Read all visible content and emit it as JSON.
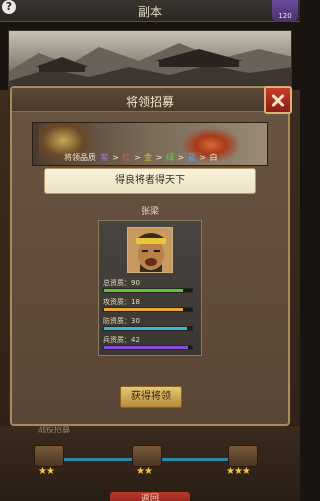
{
  "header": {
    "title": "副本",
    "help_label": "?",
    "badge_value": "120"
  },
  "dialog": {
    "title": "将领招募",
    "rank_label": "将领品质",
    "ranks": [
      "紫",
      "红",
      "金",
      "绿",
      "蓝",
      "白"
    ],
    "rank_colors": [
      "#b070e8",
      "#e85a4a",
      "#e8b838",
      "#58d058",
      "#58a8e8",
      "#f2f2f2"
    ],
    "motto": "得良将者得天下",
    "general_name": "张梁",
    "stats": [
      {
        "label": "总资质：90",
        "value": 90,
        "max": 100,
        "color": "#58c83a"
      },
      {
        "label": "攻资质：18",
        "value": 18,
        "max": 20,
        "color": "#e8a838"
      },
      {
        "label": "防资质：30",
        "value": 30,
        "max": 32,
        "color": "#38b8d8"
      },
      {
        "label": "兵资质：42",
        "value": 42,
        "max": 44,
        "color": "#8a4ad8"
      }
    ],
    "acquire_label": "获得将领"
  },
  "bottom": {
    "prev_tab_label": "战役招募",
    "back_label": "返回",
    "chests": [
      {
        "stars": "★★"
      },
      {
        "stars": "★★"
      },
      {
        "stars": "★★★"
      }
    ]
  }
}
